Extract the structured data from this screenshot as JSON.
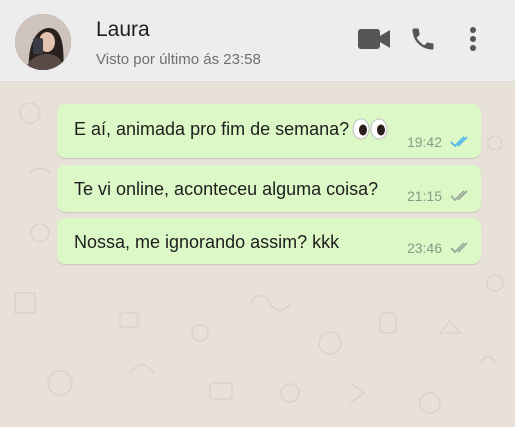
{
  "header": {
    "contact_name": "Laura",
    "status": "Visto por último ás 23:58",
    "icons": [
      "video-call-icon",
      "phone-call-icon",
      "more-options-icon"
    ]
  },
  "messages": [
    {
      "text": "E aí, animada pro fim de semana?",
      "emoji": "eyes-emoji",
      "time": "19:42",
      "status": "read",
      "tick_color": "#4fb6ec"
    },
    {
      "text": "Te vi online, aconteceu alguma coisa?",
      "time": "21:15",
      "status": "delivered",
      "tick_color": "#9aa89a"
    },
    {
      "text": "Nossa, me ignorando assim? kkk",
      "time": "23:46",
      "status": "delivered",
      "tick_color": "#9aa89a"
    }
  ],
  "colors": {
    "header_bg": "#ededed",
    "chat_bg": "#e8e1da",
    "bubble_bg": "#dcf8c6",
    "icon_color": "#555555"
  }
}
